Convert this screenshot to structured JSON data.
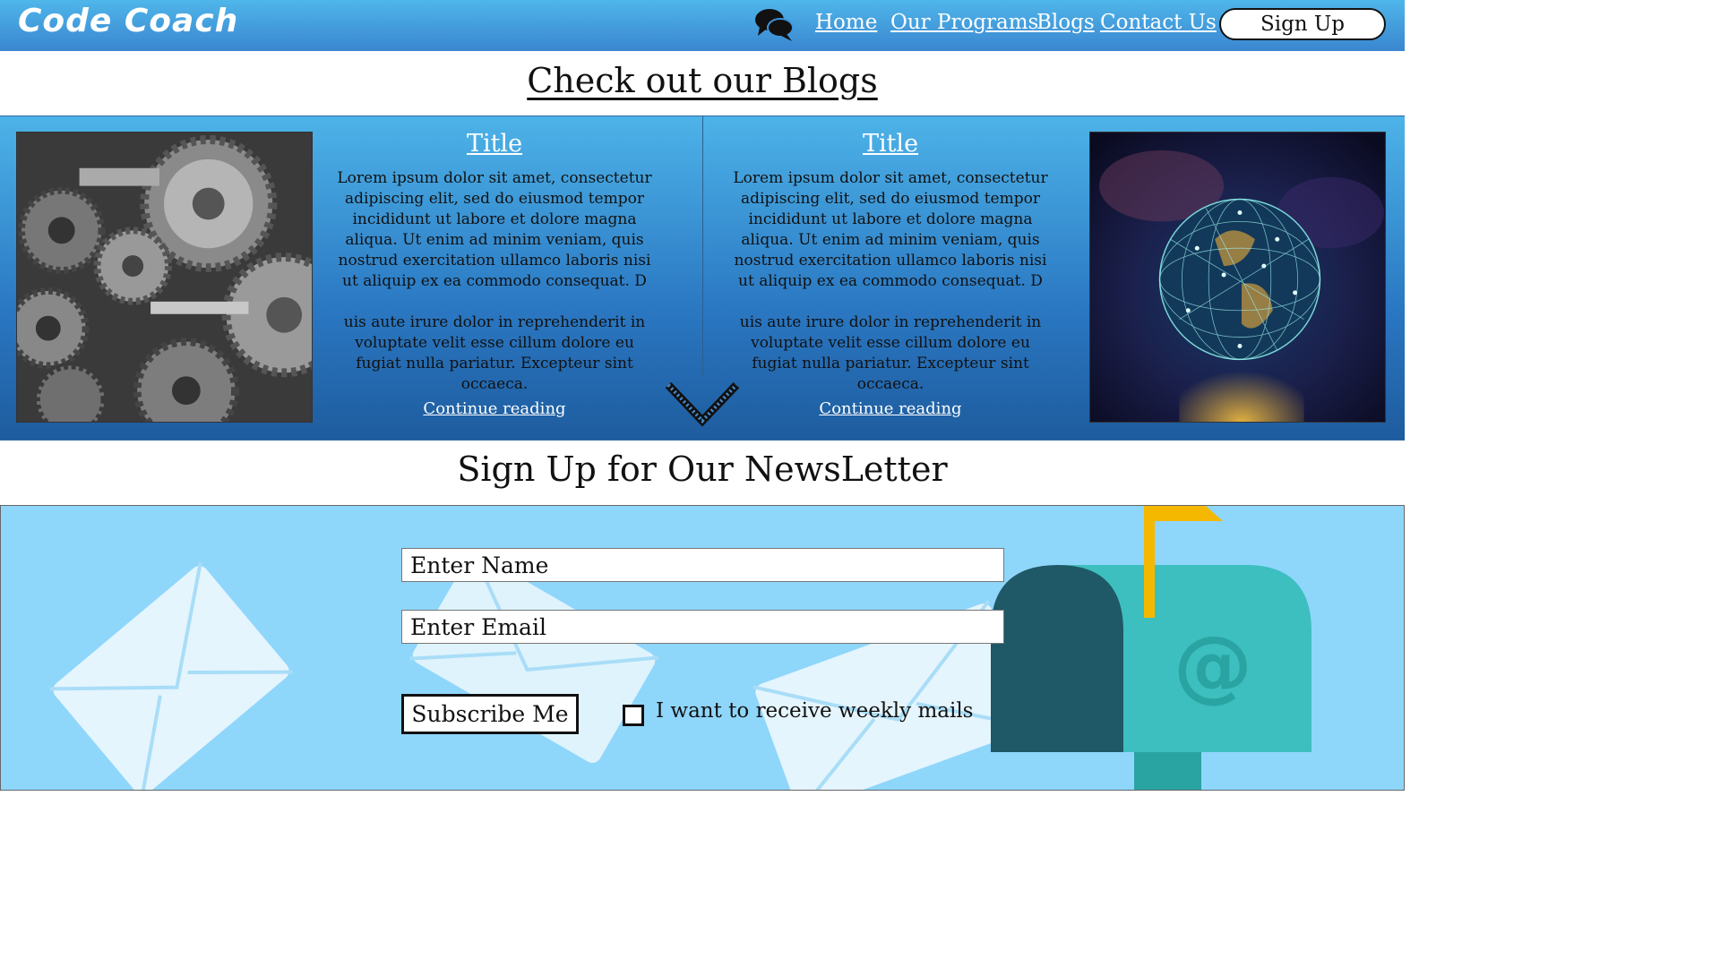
{
  "navbar": {
    "brand": "Code Coach",
    "links": [
      "Home",
      "Our Programs",
      "Blogs",
      "Contact Us"
    ],
    "signup_label": "Sign Up"
  },
  "blogs": {
    "heading": "Check out our Blogs",
    "posts": [
      {
        "title": "Title",
        "paragraph1": "Lorem ipsum dolor sit amet, consectetur adipiscing elit, sed do eiusmod tempor incididunt ut labore et dolore magna aliqua. Ut enim ad minim veniam, quis nostrud exercitation ullamco laboris nisi ut aliquip ex ea commodo consequat. D",
        "paragraph2": "uis aute irure dolor in reprehenderit in voluptate velit esse cillum dolore eu fugiat nulla pariatur. Excepteur sint occaeca.",
        "link": "Continue reading",
        "image": "gears-photo"
      },
      {
        "title": "Title",
        "paragraph1": "Lorem ipsum dolor sit amet, consectetur adipiscing elit, sed do eiusmod tempor incididunt ut labore et dolore magna aliqua. Ut enim ad minim veniam, quis nostrud exercitation ullamco laboris nisi ut aliquip ex ea commodo consequat. D",
        "paragraph2": "uis aute irure dolor in reprehenderit in voluptate velit esse cillum dolore eu fugiat nulla pariatur. Excepteur sint occaeca.",
        "link": "Continue reading",
        "image": "network-globe-photo"
      }
    ]
  },
  "newsletter": {
    "heading": "Sign Up for Our NewsLetter",
    "name_placeholder": "Enter Name",
    "email_placeholder": "Enter Email",
    "subscribe_label": "Subscribe Me",
    "checkbox_label": "I want to receive weekly mails",
    "mailbox_symbol": "@"
  },
  "colors": {
    "nav_top": "#4fb6ea",
    "nav_bottom": "#3a86d0",
    "newsletter_bg": "#8fd6fb",
    "mailbox_teal": "#3dbfbf",
    "mailbox_dark": "#1f5866",
    "flag_yellow": "#f5b800"
  }
}
